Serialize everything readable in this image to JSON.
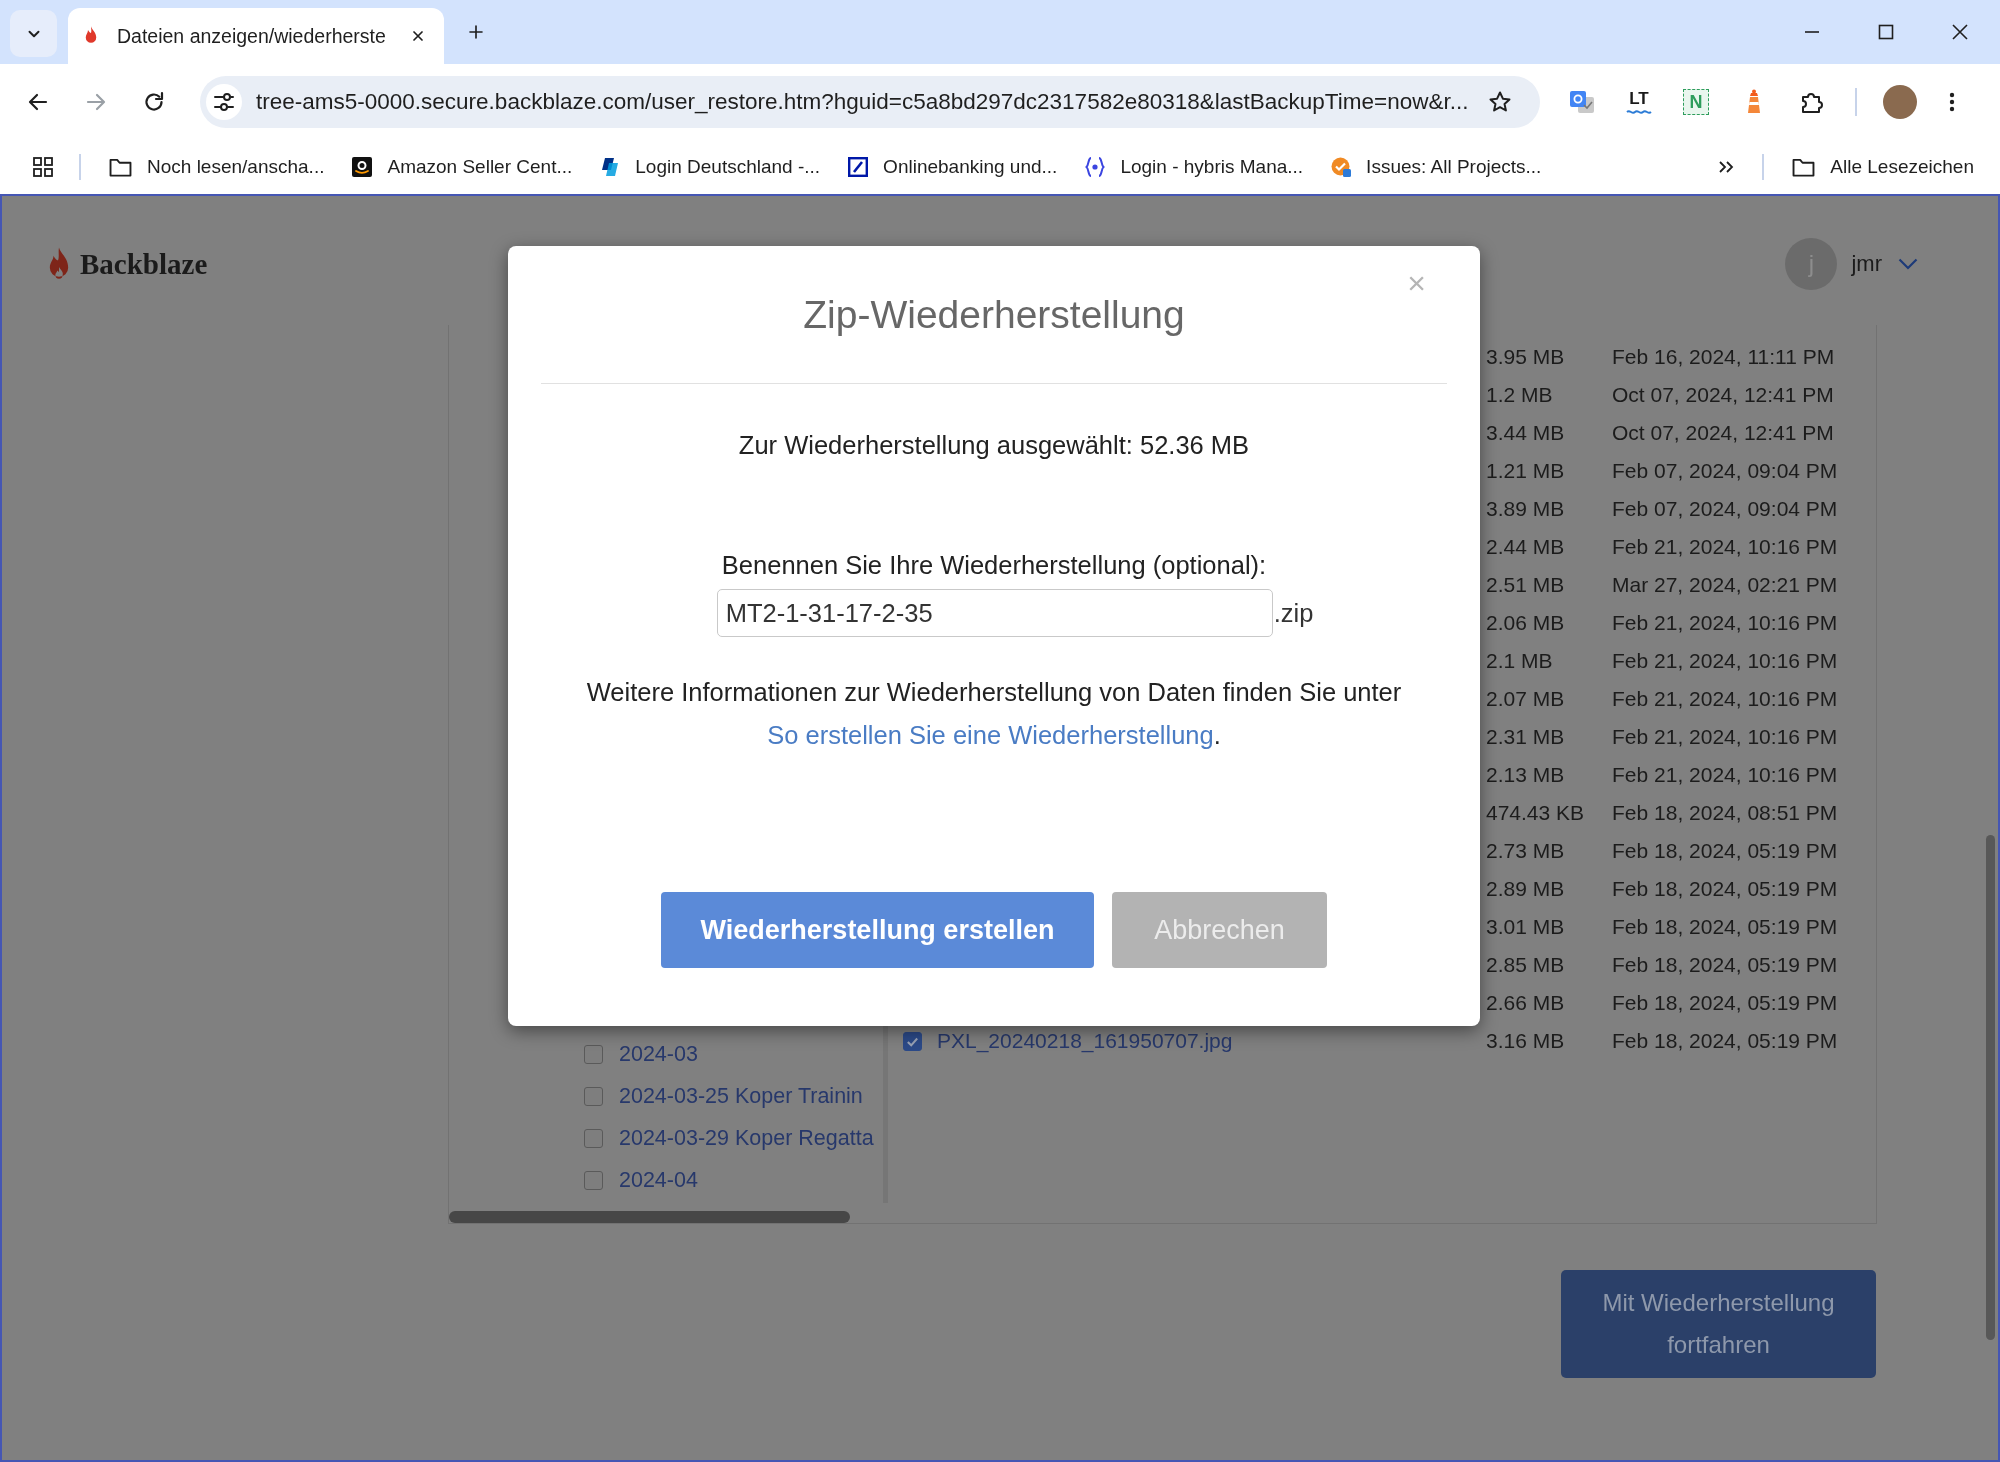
{
  "browser": {
    "tabs": [
      {
        "title": "Dateien anzeigen/wiederherste",
        "selected": true
      }
    ],
    "url": "tree-ams5-0000.secure.backblaze.com/user_restore.htm?hguid=c5a8bd297dc2317582e80318&lastBackupTime=now&r...",
    "extensions": [
      {
        "label": "LT",
        "kind": "wave"
      },
      {
        "label": "N",
        "kind": "framed"
      }
    ],
    "bookmarks": [
      {
        "label": "Noch lesen/anscha...",
        "kind": "folder"
      },
      {
        "label": "Amazon Seller Cent...",
        "kind": "shop"
      },
      {
        "label": "Login Deutschland -...",
        "kind": "payment"
      },
      {
        "label": "Onlinebanking und...",
        "kind": "bank"
      },
      {
        "label": "Login - hybris Mana...",
        "kind": "brackets"
      },
      {
        "label": "Issues: All Projects...",
        "kind": "tracker"
      }
    ],
    "all_bookmarks": "Alle Lesezeichen"
  },
  "header": {
    "logo": "Backblaze",
    "user_initial": "j",
    "user_name": "jmr"
  },
  "folders": [
    {
      "name": "2024-03",
      "checked": false
    },
    {
      "name": "2024-03-25 Koper Trainin",
      "checked": false
    },
    {
      "name": "2024-03-29 Koper Regatta",
      "checked": false
    },
    {
      "name": "2024-04",
      "checked": false
    }
  ],
  "files": [
    {
      "size": "3.95 MB",
      "modified": "Feb 16, 2024, 11:11 PM"
    },
    {
      "size": "1.2 MB",
      "modified": "Oct 07, 2024, 12:41 PM"
    },
    {
      "size": "3.44 MB",
      "modified": "Oct 07, 2024, 12:41 PM"
    },
    {
      "size": "1.21 MB",
      "modified": "Feb 07, 2024, 09:04 PM"
    },
    {
      "size": "3.89 MB",
      "modified": "Feb 07, 2024, 09:04 PM"
    },
    {
      "size": "2.44 MB",
      "modified": "Feb 21, 2024, 10:16 PM"
    },
    {
      "size": "2.51 MB",
      "modified": "Mar 27, 2024, 02:21 PM"
    },
    {
      "size": "2.06 MB",
      "modified": "Feb 21, 2024, 10:16 PM"
    },
    {
      "size": "2.1 MB",
      "modified": "Feb 21, 2024, 10:16 PM"
    },
    {
      "size": "2.07 MB",
      "modified": "Feb 21, 2024, 10:16 PM"
    },
    {
      "size": "2.31 MB",
      "modified": "Feb 21, 2024, 10:16 PM"
    },
    {
      "size": "2.13 MB",
      "modified": "Feb 21, 2024, 10:16 PM"
    },
    {
      "size": "474.43 KB",
      "modified": "Feb 18, 2024, 08:51 PM"
    },
    {
      "size": "2.73 MB",
      "modified": "Feb 18, 2024, 05:19 PM"
    },
    {
      "size": "2.89 MB",
      "modified": "Feb 18, 2024, 05:19 PM"
    },
    {
      "size": "3.01 MB",
      "modified": "Feb 18, 2024, 05:19 PM"
    },
    {
      "size": "2.85 MB",
      "modified": "Feb 18, 2024, 05:19 PM"
    },
    {
      "size": "2.66 MB",
      "modified": "Feb 18, 2024, 05:19 PM"
    },
    {
      "name": "PXL_20240218_161950707.jpg",
      "checked": true,
      "size": "3.16 MB",
      "modified": "Feb 18, 2024, 05:19 PM"
    }
  ],
  "continue_button": "Mit Wiederherstellung fortfahren",
  "dialog": {
    "close": "×",
    "title": "Zip-Wiederherstellung",
    "selected_size": "Zur Wiederherstellung ausgewählt: 52.36 MB",
    "name_label": "Benennen Sie Ihre Wiederherstellung (optional):",
    "name_value": "MT2-1-31-17-2-35",
    "extension": ".zip",
    "info_text": "Weitere Informationen zur Wiederherstellung von Daten finden Sie unter",
    "info_link": "So erstellen Sie eine Wiederherstellung",
    "info_end": ".",
    "buttons": [
      {
        "label": "Wiederherstellung erstellen",
        "kind": "primary"
      },
      {
        "label": "Abbrechen",
        "kind": "secondary"
      }
    ]
  }
}
